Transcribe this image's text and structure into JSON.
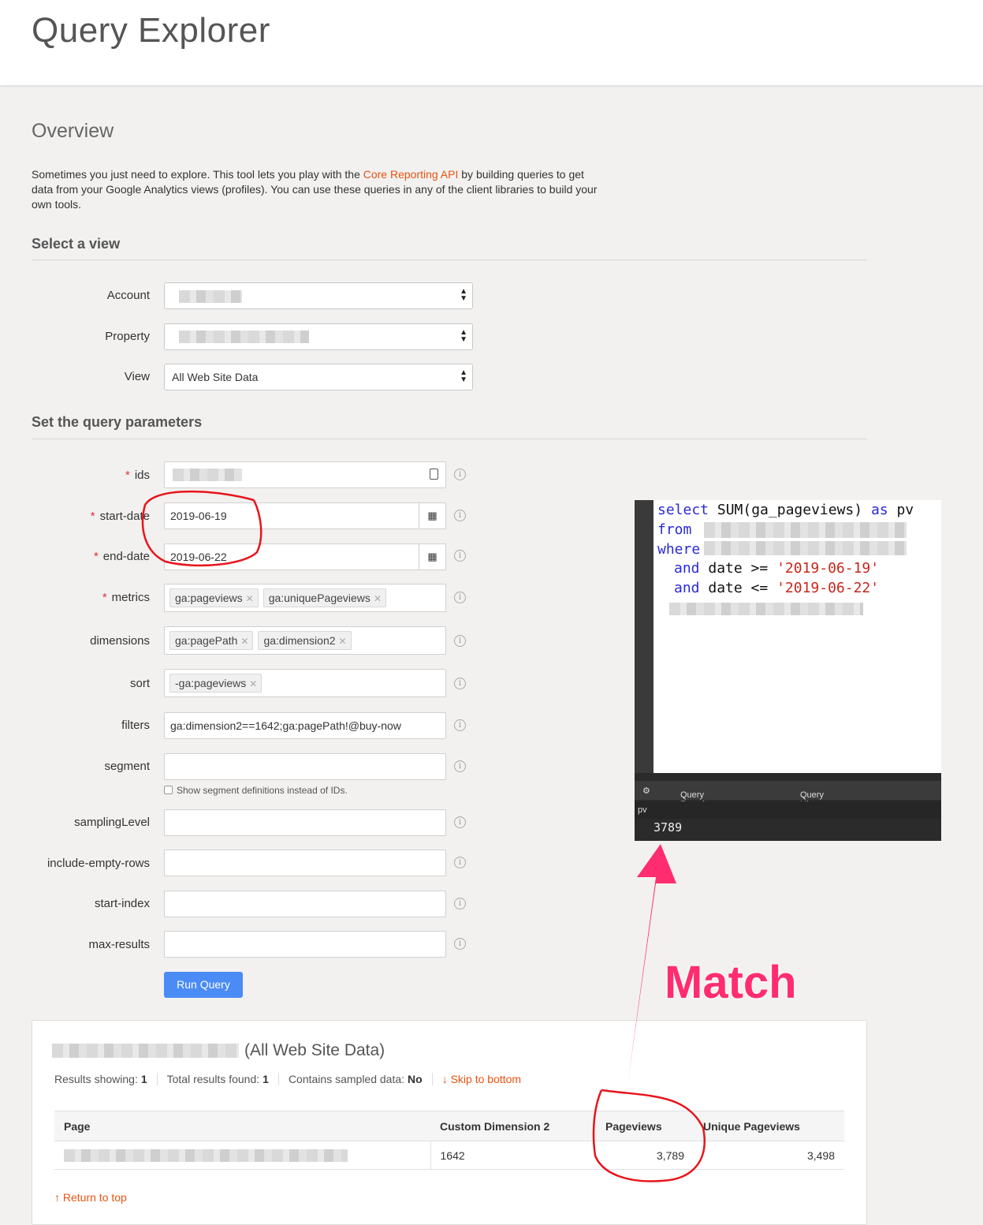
{
  "header": {
    "title": "Query Explorer"
  },
  "overview": {
    "title": "Overview",
    "text_before": "Sometimes you just need to explore. This tool lets you play with the ",
    "link": "Core Reporting API",
    "text_after": " by building queries to get data from your Google Analytics views (profiles). You can use these queries in any of the client libraries to build your own tools."
  },
  "select_view": {
    "title": "Select a view",
    "account_label": "Account",
    "property_label": "Property",
    "view_label": "View",
    "view_value": "All Web Site Data"
  },
  "params": {
    "title": "Set the query parameters",
    "ids_label": "ids",
    "start_date_label": "start-date",
    "start_date_value": "2019-06-19",
    "end_date_label": "end-date",
    "end_date_value": "2019-06-22",
    "metrics_label": "metrics",
    "metrics": [
      "ga:pageviews",
      "ga:uniquePageviews"
    ],
    "dimensions_label": "dimensions",
    "dimensions": [
      "ga:pagePath",
      "ga:dimension2"
    ],
    "sort_label": "sort",
    "sort": [
      "-ga:pageviews"
    ],
    "filters_label": "filters",
    "filters_value": "ga:dimension2==1642;ga:pagePath!@buy-now",
    "segment_label": "segment",
    "segment_checkbox": "Show segment definitions instead of IDs.",
    "sampling_label": "samplingLevel",
    "empty_rows_label": "include-empty-rows",
    "start_index_label": "start-index",
    "max_results_label": "max-results",
    "run_button": "Run Query",
    "required_mark": "*"
  },
  "results": {
    "title": "(All Web Site Data)",
    "showing_label": "Results showing:",
    "showing_value": "1",
    "total_label": "Total results found:",
    "total_value": "1",
    "sampled_label": "Contains sampled data:",
    "sampled_value": "No",
    "skip_link": "↓ Skip to bottom",
    "columns": [
      "Page",
      "Custom Dimension 2",
      "Pageviews",
      "Unique Pageviews"
    ],
    "row": {
      "dimension2": "1642",
      "pageviews": "3,789",
      "unique": "3,498"
    },
    "return_top": "↑ Return to top"
  },
  "sql_editor": {
    "line1_kw": "select",
    "line1_rest": " SUM(ga_pageviews) ",
    "line1_kw2": "as",
    "line1_end": " pv",
    "line2": "from",
    "line3": "where",
    "line4_kw": "and",
    "line4_mid": " date >= ",
    "line4_str": "'2019-06-19'",
    "line5_kw": "and",
    "line5_mid": " date <= ",
    "line5_str": "'2019-06-22'",
    "favorites": "Query Favorites",
    "history": "Query History",
    "col_header": "pv",
    "result": "3789"
  },
  "annotation": {
    "label": "Match",
    "color": "#ff2d6f",
    "circle_color": "#e8141b"
  }
}
